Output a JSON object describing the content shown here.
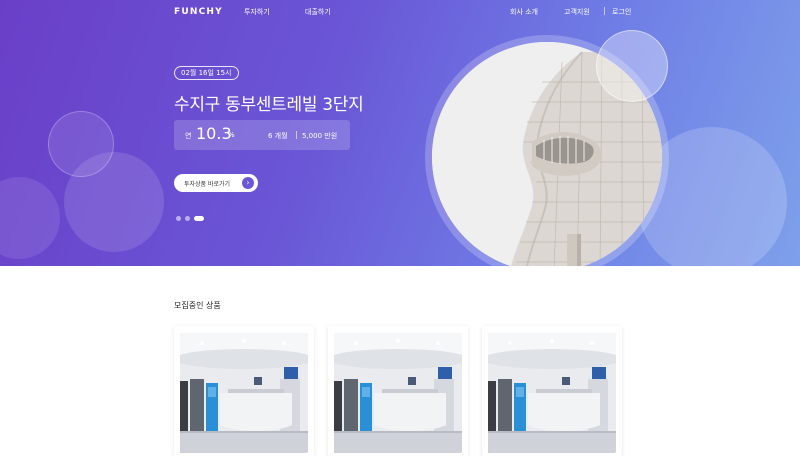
{
  "nav": {
    "logo": "FUNCHY",
    "items": [
      {
        "label": "투자하기"
      },
      {
        "label": "대출하기"
      },
      {
        "label": "회사 소개"
      },
      {
        "label": "고객지원"
      },
      {
        "label": "로그인"
      }
    ]
  },
  "hero": {
    "date": "02월 16일 15시",
    "title": "수지구 동부센트레빌 3단지",
    "rate_prefix": "연",
    "rate": "10.3",
    "rate_unit": "%",
    "period": "6 개월",
    "amount": "5,000 만원",
    "cta_label": "투자상품 바로가기",
    "cta_icon": "arrow-right-icon",
    "carousel": {
      "count": 3,
      "active": 3
    }
  },
  "section": {
    "title": "모집중인 상품"
  },
  "products": [
    {
      "image": "lobby-reception-photo"
    },
    {
      "image": "lobby-reception-photo"
    },
    {
      "image": "lobby-reception-photo"
    }
  ],
  "colors": {
    "hero_start": "#6a3fc8",
    "hero_end": "#7ea0ea",
    "accent": "#6a56d6"
  }
}
